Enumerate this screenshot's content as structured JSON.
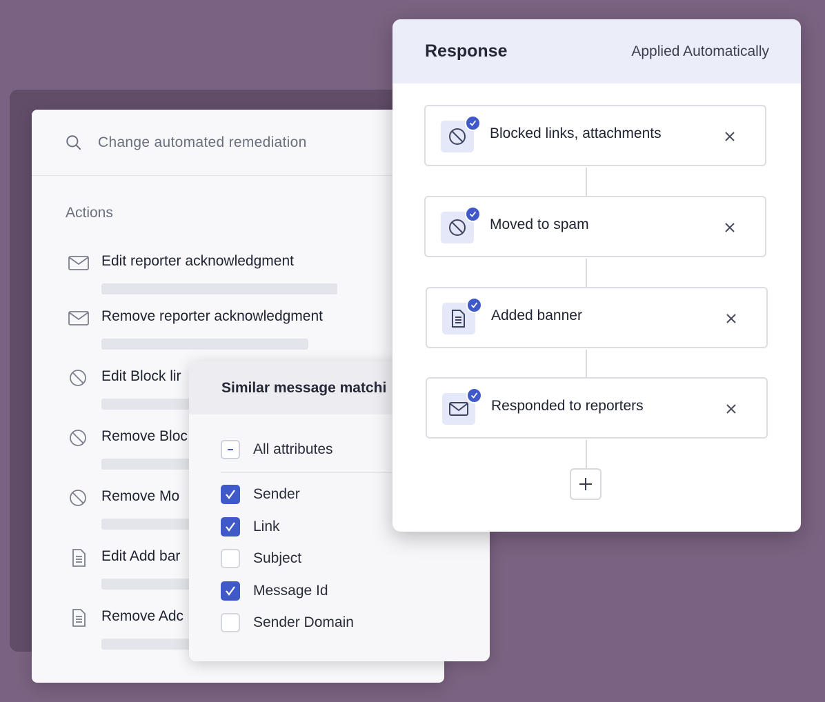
{
  "search": {
    "placeholder": "Change automated remediation"
  },
  "actions": {
    "title": "Actions",
    "items": [
      {
        "icon": "mail-icon",
        "label": "Edit reporter acknowledgment"
      },
      {
        "icon": "mail-icon",
        "label": "Remove reporter acknowledgment"
      },
      {
        "icon": "block-icon",
        "label": "Edit Block lir"
      },
      {
        "icon": "block-icon",
        "label": "Remove Bloc"
      },
      {
        "icon": "block-icon",
        "label": "Remove Mo"
      },
      {
        "icon": "document-icon",
        "label": "Edit Add bar"
      },
      {
        "icon": "document-icon",
        "label": "Remove Adc"
      }
    ]
  },
  "matching": {
    "title": "Similar message matchi",
    "all_label": "All attributes",
    "attributes": [
      {
        "label": "Sender",
        "checked": true
      },
      {
        "label": "Link",
        "checked": true
      },
      {
        "label": "Subject",
        "checked": false
      },
      {
        "label": "Message Id",
        "checked": true
      },
      {
        "label": "Sender Domain",
        "checked": false
      }
    ]
  },
  "response": {
    "title": "Response",
    "subtitle": "Applied Automatically",
    "steps": [
      {
        "icon": "block-icon",
        "label": "Blocked links, attachments"
      },
      {
        "icon": "block-icon",
        "label": "Moved to spam"
      },
      {
        "icon": "document-icon",
        "label": "Added banner"
      },
      {
        "icon": "mail-icon",
        "label": "Responded to reporters"
      }
    ]
  },
  "colors": {
    "background": "#7a6282",
    "accent": "#3f5ac8",
    "icon_tile": "#e4e8f8"
  }
}
